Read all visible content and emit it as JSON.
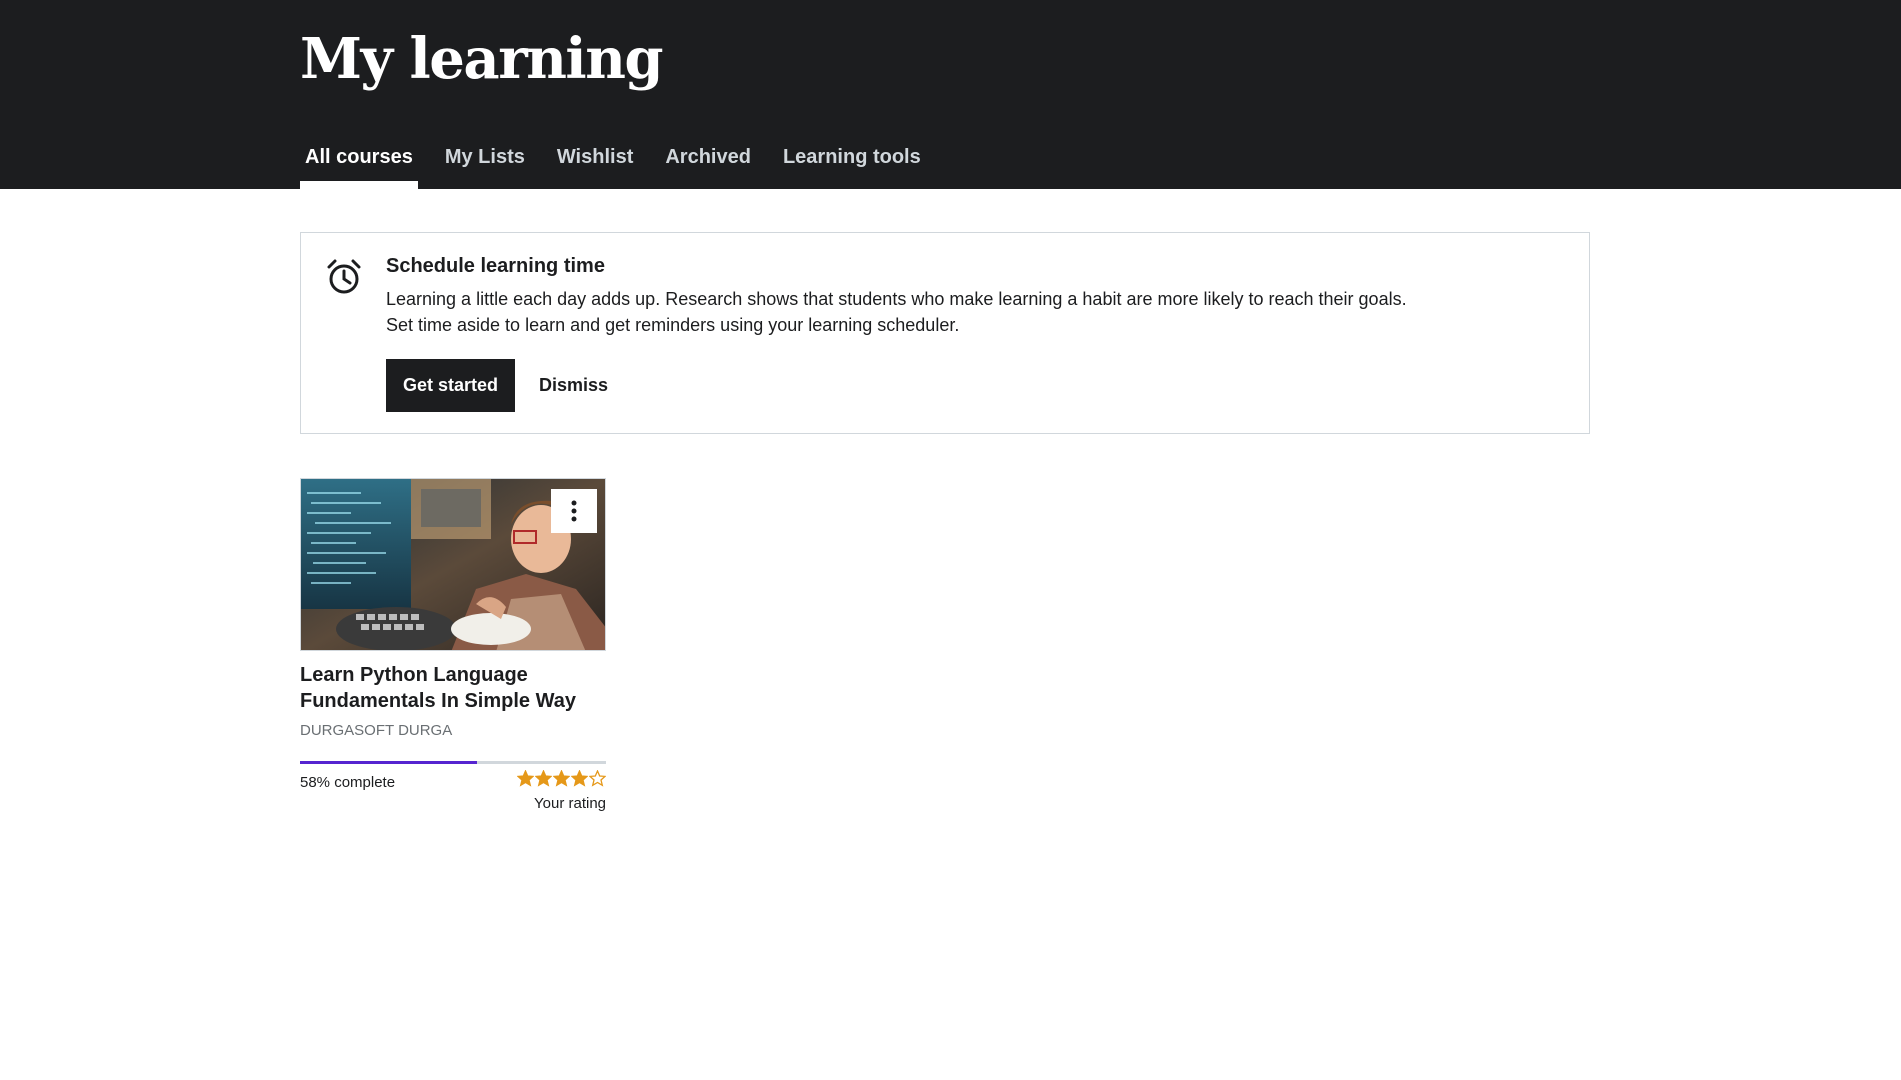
{
  "header": {
    "title": "My learning",
    "tabs": [
      {
        "label": "All courses",
        "active": true
      },
      {
        "label": "My Lists",
        "active": false
      },
      {
        "label": "Wishlist",
        "active": false
      },
      {
        "label": "Archived",
        "active": false
      },
      {
        "label": "Learning tools",
        "active": false
      }
    ]
  },
  "scheduler": {
    "icon": "alarm-clock-icon",
    "title": "Schedule learning time",
    "line1": "Learning a little each day adds up. Research shows that students who make learning a habit are more likely to reach their goals.",
    "line2": "Set time aside to learn and get reminders using your learning scheduler.",
    "primary_button": "Get started",
    "secondary_button": "Dismiss"
  },
  "courses": [
    {
      "title": "Learn Python Language Fundamentals In Simple Way",
      "instructor": "DURGASOFT DURGA",
      "progress_percent": 58,
      "progress_label": "58% complete",
      "rating": 4,
      "rating_max": 5,
      "rating_label": "Your rating",
      "menu_icon": "kebab-menu-icon"
    }
  ],
  "colors": {
    "header_bg": "#1c1d1f",
    "progress": "#5624d0",
    "star": "#e59819",
    "border": "#d1d7dc"
  }
}
